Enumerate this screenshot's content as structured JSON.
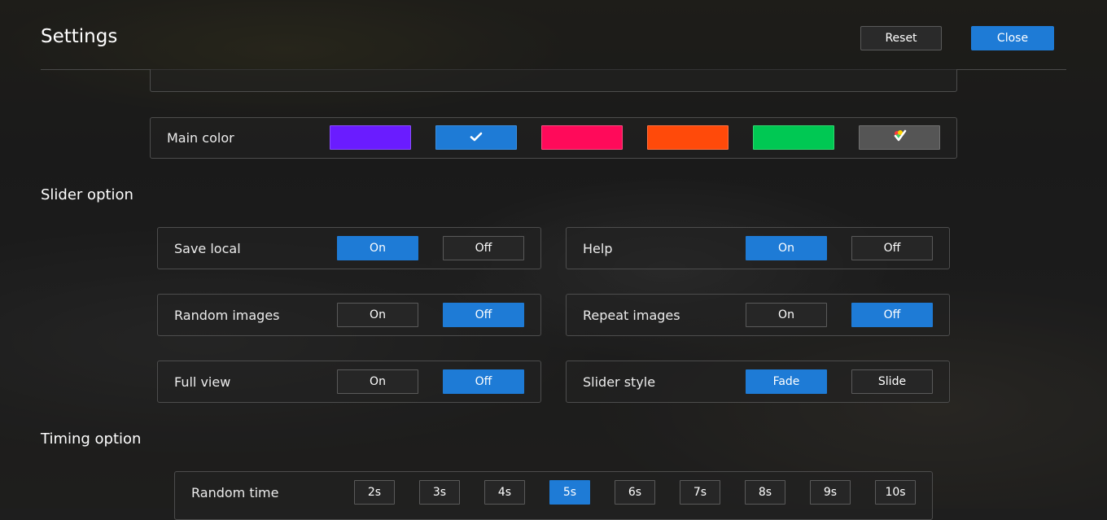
{
  "header": {
    "title": "Settings",
    "reset_label": "Reset",
    "close_label": "Close"
  },
  "main_color": {
    "label": "Main color",
    "swatches": [
      {
        "color": "#6a1cff",
        "selected": false
      },
      {
        "color": "#1e7bd6",
        "selected": true
      },
      {
        "color": "#ff0a5a",
        "selected": false
      },
      {
        "color": "#ff4a0a",
        "selected": false
      },
      {
        "color": "#00c853",
        "selected": false
      },
      {
        "color": "#555555",
        "icon": "color-picker-icon"
      }
    ]
  },
  "slider_section": {
    "title": "Slider option"
  },
  "options": {
    "save_local": {
      "label": "Save local",
      "on": "On",
      "off": "Off",
      "value": "On"
    },
    "help": {
      "label": "Help",
      "on": "On",
      "off": "Off",
      "value": "On"
    },
    "random_images": {
      "label": "Random images",
      "on": "On",
      "off": "Off",
      "value": "Off"
    },
    "repeat_images": {
      "label": "Repeat images",
      "on": "On",
      "off": "Off",
      "value": "Off"
    },
    "full_view": {
      "label": "Full view",
      "on": "On",
      "off": "Off",
      "value": "Off"
    },
    "slider_style": {
      "label": "Slider style",
      "a": "Fade",
      "b": "Slide",
      "value": "Fade"
    }
  },
  "timing_section": {
    "title": "Timing option"
  },
  "random_time": {
    "label": "Random time",
    "values": [
      "2s",
      "3s",
      "4s",
      "5s",
      "6s",
      "7s",
      "8s",
      "9s",
      "10s"
    ],
    "selected": "5s"
  },
  "colors": {
    "accent": "#1e7bd6"
  }
}
